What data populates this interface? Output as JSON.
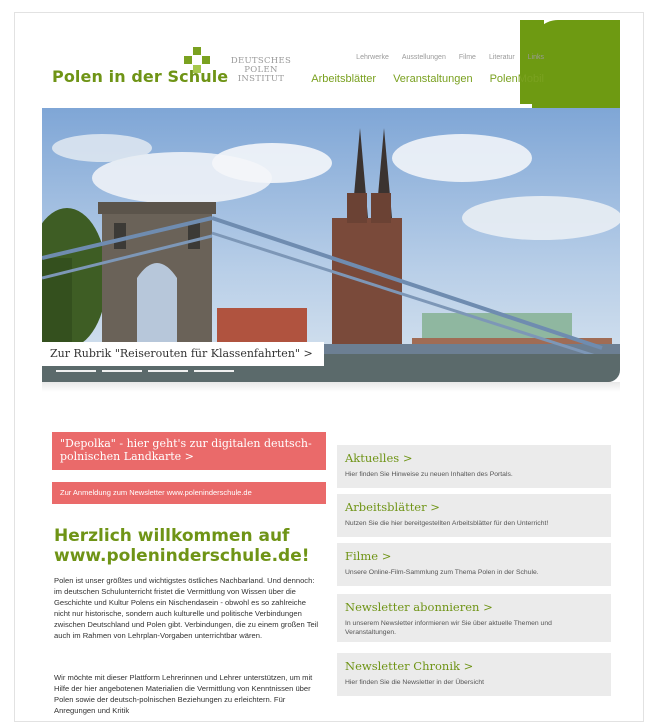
{
  "header": {
    "logo_text": "Polen in der Schule",
    "partner_logo_lines": [
      "DEUTSCHES",
      "POLEN",
      "INSTITUT"
    ],
    "top_nav": [
      "Lehrwerke",
      "Ausstellungen",
      "Filme",
      "Literatur",
      "Links"
    ],
    "main_nav": [
      "Arbeitsblätter",
      "Veranstaltungen",
      "PolenMobil"
    ]
  },
  "hero": {
    "caption": "Zur Rubrik \"Reiserouten für Klassenfahrten\" >"
  },
  "left": {
    "banner_map": "\"Depolka\" - hier geht's zur digitalen deutsch-polnischen Landkarte >",
    "banner_newsletter": "Zur Anmeldung zum Newsletter www.poleninderschule.de",
    "welcome_title": "Herzlich willkommen auf www.poleninderschule.de!",
    "paragraph1": "Polen ist unser größtes und wichtigstes östliches Nachbarland. Und dennoch: im deutschen Schulunterricht fristet die Vermittlung von Wissen über die Geschichte und Kultur Polens ein Nischendasein - obwohl es so zahlreiche nicht nur historische, sondern auch kulturelle und politische Verbindungen zwischen Deutschland und Polen gibt. Verbindungen, die zu einem großen Teil auch im Rahmen von Lehrplan-Vorgaben unterrichtbar wären.",
    "paragraph2": "Wir möchte mit dieser Plattform Lehrerinnen und Lehrer unterstützen, um mit Hilfe der hier angebotenen Materialien die Vermittlung von Kenntnissen über Polen sowie der deutsch-polnischen Beziehungen zu erleichtern. Für Anregungen und Kritik"
  },
  "cards": [
    {
      "title": "Aktuelles >",
      "desc": "Hier finden Sie Hinweise zu neuen Inhalten des Portals."
    },
    {
      "title": "Arbeitsblätter >",
      "desc": "Nutzen Sie die hier bereitgestellten Arbeitsblätter für den Unterricht!"
    },
    {
      "title": "Filme >",
      "desc": "Unsere Online-Film-Sammlung zum Thema Polen in der Schule."
    },
    {
      "title": "Newsletter abonnieren >",
      "desc": "In unserem Newsletter informieren wir Sie über aktuelle Themen und Veranstaltungen."
    },
    {
      "title": "Newsletter Chronik >",
      "desc": "Hier finden Sie die Newsletter in der Übersicht"
    }
  ],
  "colors": {
    "brand_green": "#6f9416",
    "banner_red": "#ea6a6a",
    "card_grey": "#ebebeb"
  }
}
